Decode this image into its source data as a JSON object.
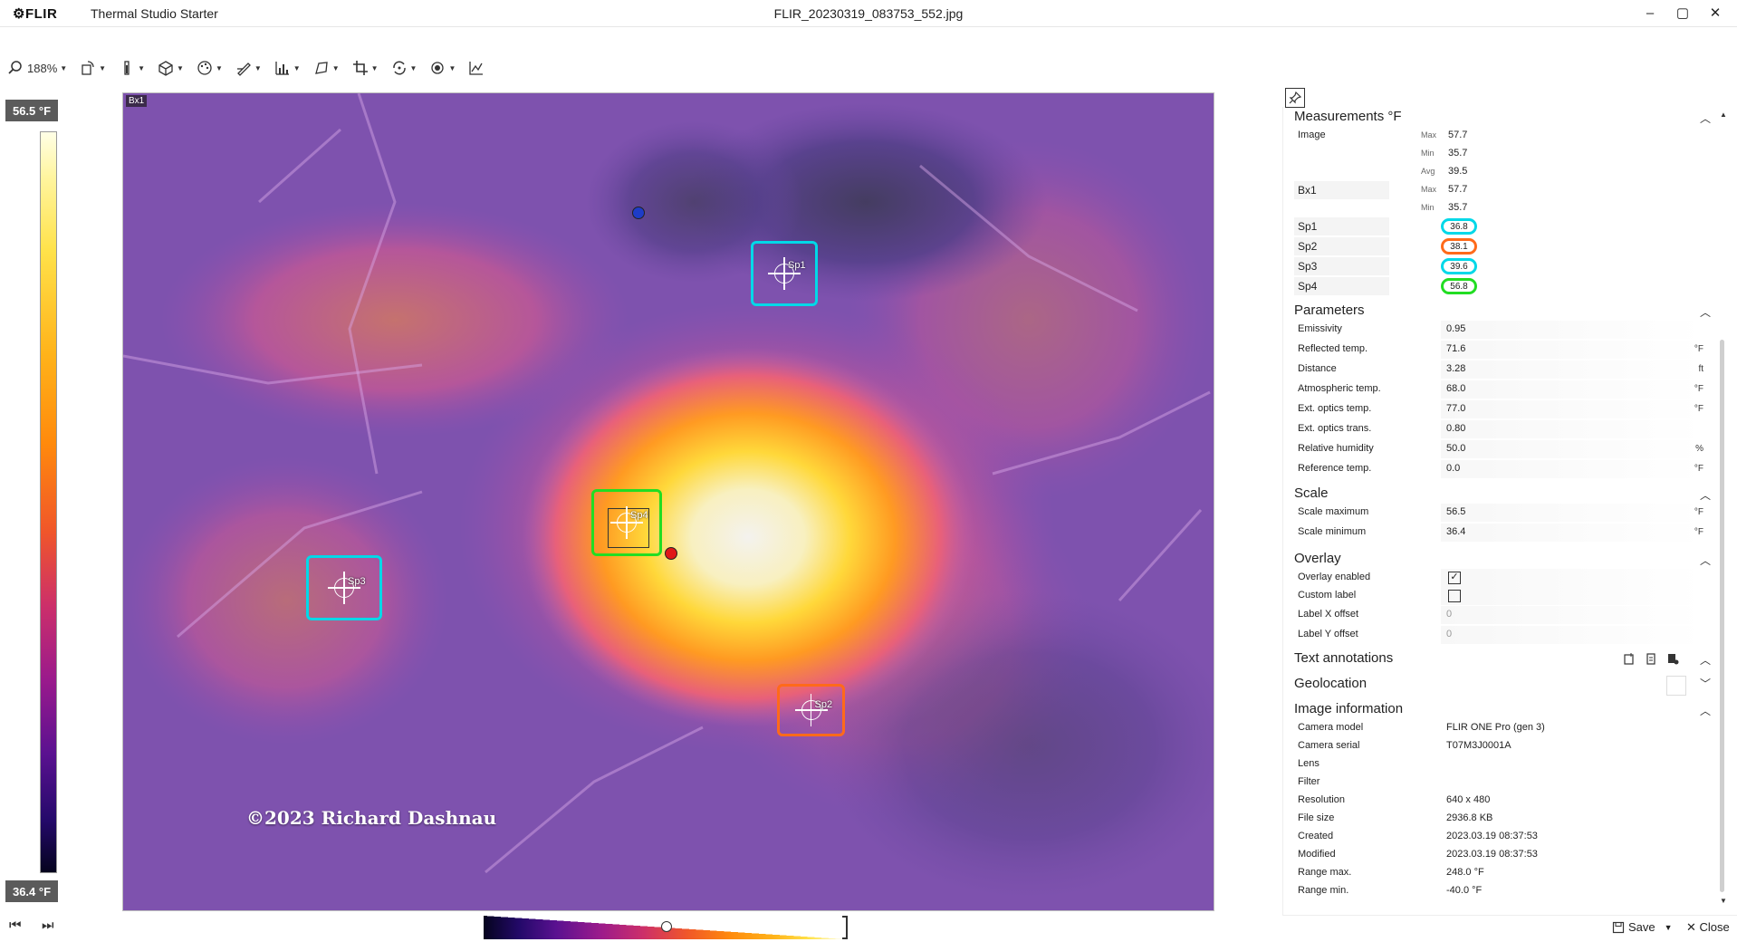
{
  "app": {
    "logo": "FLIR",
    "name": "Thermal Studio Starter",
    "filename": "FLIR_20230319_083753_552.jpg",
    "window_buttons": [
      "–",
      "▢",
      "✕"
    ]
  },
  "toolbar": {
    "zoom": "188%",
    "tools": [
      "zoom-tool",
      "rotate-tool",
      "measure-tool",
      "object-tool",
      "palette-tool",
      "draw-tool",
      "chart-tool",
      "transform-tool",
      "crop-tool",
      "fusion-tool",
      "filter-tool",
      "plot-tool"
    ]
  },
  "scale": {
    "max_label": "56.5 °F",
    "min_label": "36.4 °F"
  },
  "image": {
    "box_label": "Bx1",
    "copyright": "©2023 Richard Dashnau",
    "spots": [
      {
        "name": "Sp1",
        "color": "#00d8e8"
      },
      {
        "name": "Sp2",
        "color": "#ff6a1a"
      },
      {
        "name": "Sp3",
        "color": "#00d8e8"
      },
      {
        "name": "Sp4",
        "color": "#22dd22"
      }
    ]
  },
  "nav": {
    "prev": "⏮",
    "next": "⏭"
  },
  "panel": {
    "measurements": {
      "title": "Measurements °F",
      "image_label": "Image",
      "max_label": "Max",
      "min_label": "Min",
      "avg_label": "Avg",
      "image_max": "57.7",
      "image_min": "35.7",
      "image_avg": "39.5",
      "box_label": "Bx1",
      "box_max": "57.7",
      "box_min": "35.7",
      "spots": [
        {
          "label": "Sp1",
          "value": "36.8",
          "color": "#00d8e8"
        },
        {
          "label": "Sp2",
          "value": "38.1",
          "color": "#ff6a1a"
        },
        {
          "label": "Sp3",
          "value": "39.6",
          "color": "#00d8e8"
        },
        {
          "label": "Sp4",
          "value": "56.8",
          "color": "#22dd22"
        }
      ]
    },
    "parameters": {
      "title": "Parameters",
      "rows": [
        {
          "label": "Emissivity",
          "value": "0.95",
          "unit": ""
        },
        {
          "label": "Reflected temp.",
          "value": "71.6",
          "unit": "°F"
        },
        {
          "label": "Distance",
          "value": "3.28",
          "unit": "ft"
        },
        {
          "label": "Atmospheric temp.",
          "value": "68.0",
          "unit": "°F"
        },
        {
          "label": "Ext. optics temp.",
          "value": "77.0",
          "unit": "°F"
        },
        {
          "label": "Ext. optics trans.",
          "value": "0.80",
          "unit": ""
        },
        {
          "label": "Relative humidity",
          "value": "50.0",
          "unit": "%"
        },
        {
          "label": "Reference temp.",
          "value": "0.0",
          "unit": "°F"
        }
      ]
    },
    "scale": {
      "title": "Scale",
      "rows": [
        {
          "label": "Scale maximum",
          "value": "56.5",
          "unit": "°F"
        },
        {
          "label": "Scale minimum",
          "value": "36.4",
          "unit": "°F"
        }
      ]
    },
    "overlay": {
      "title": "Overlay",
      "overlay_enabled_label": "Overlay enabled",
      "overlay_enabled": "✓",
      "custom_label_label": "Custom label",
      "custom_label": "",
      "label_x_label": "Label X offset",
      "label_x": "0",
      "label_y_label": "Label Y offset",
      "label_y": "0"
    },
    "text_annotations": {
      "title": "Text annotations"
    },
    "geolocation": {
      "title": "Geolocation"
    },
    "image_information": {
      "title": "Image information",
      "rows": [
        {
          "label": "Camera model",
          "value": "FLIR ONE Pro (gen 3)"
        },
        {
          "label": "Camera serial",
          "value": "T07M3J0001A"
        },
        {
          "label": "Lens",
          "value": ""
        },
        {
          "label": "Filter",
          "value": ""
        },
        {
          "label": "Resolution",
          "value": "640 x 480"
        },
        {
          "label": "File size",
          "value": "2936.8 KB"
        },
        {
          "label": "Created",
          "value": "2023.03.19 08:37:53"
        },
        {
          "label": "Modified",
          "value": "2023.03.19 08:37:53"
        },
        {
          "label": "Range max.",
          "value": "248.0 °F"
        },
        {
          "label": "Range min.",
          "value": "-40.0 °F"
        }
      ]
    },
    "footer": {
      "save": "Save",
      "close": "Close"
    }
  }
}
